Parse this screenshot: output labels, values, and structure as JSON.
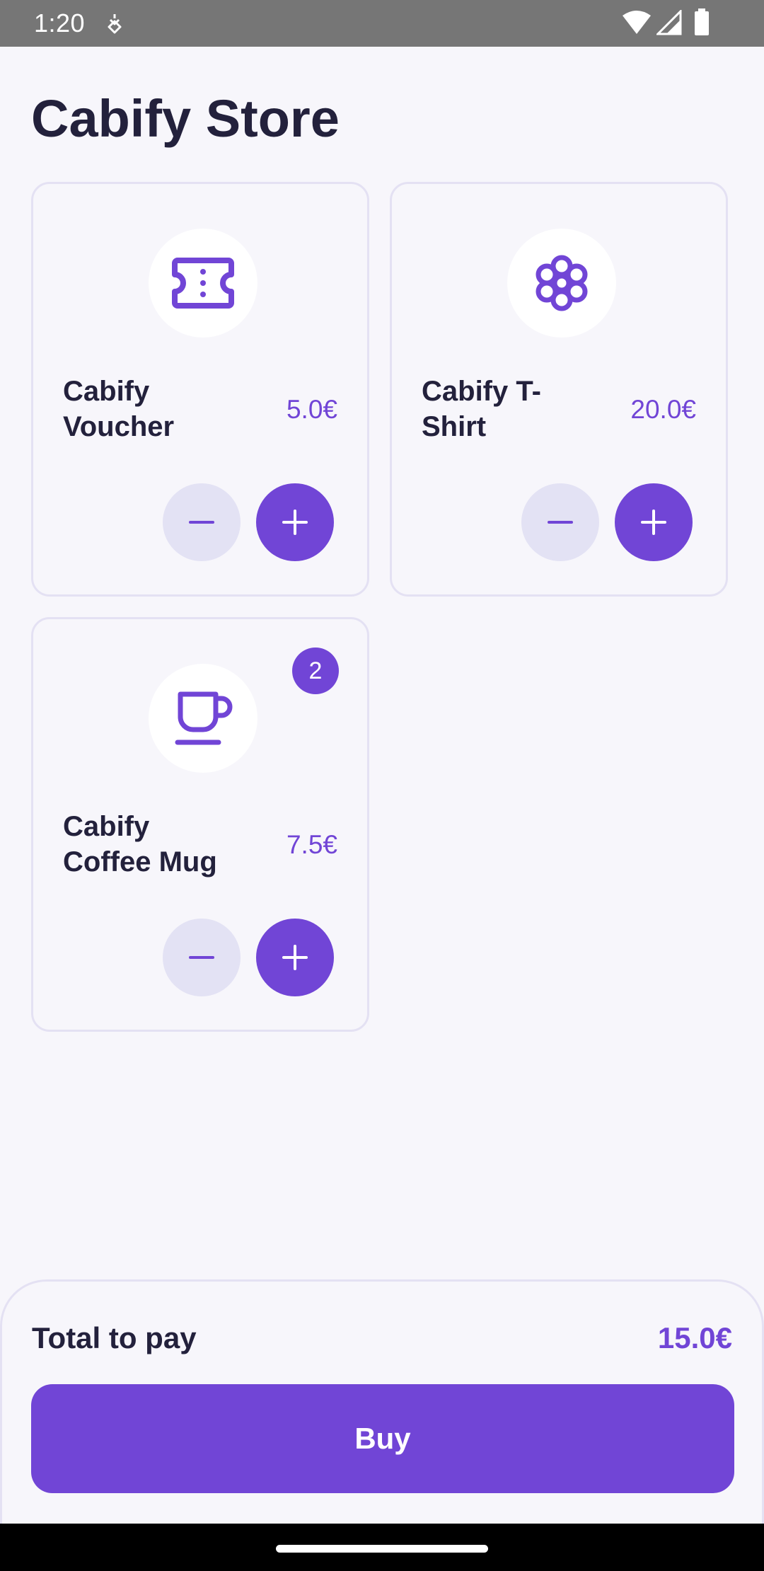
{
  "status_bar": {
    "time": "1:20",
    "icons": [
      "notification-icon",
      "wifi-icon",
      "signal-icon",
      "battery-icon"
    ]
  },
  "header": {
    "title": "Cabify Store"
  },
  "products": [
    {
      "name": "Cabify Voucher",
      "price": "5.0€",
      "icon": "voucher-ticket-icon",
      "quantity": null
    },
    {
      "name": "Cabify T-Shirt",
      "price": "20.0€",
      "icon": "flower-icon",
      "quantity": null
    },
    {
      "name": "Cabify Coffee Mug",
      "price": "7.5€",
      "icon": "coffee-mug-icon",
      "quantity": "2"
    }
  ],
  "cart": {
    "total_label": "Total to pay",
    "total_value": "15.0€",
    "buy_label": "Buy"
  },
  "colors": {
    "accent": "#7145d6",
    "accent_light": "#e3e2f4",
    "text_primary": "#23213c",
    "background": "#f7f6fb",
    "border": "#e4e1f3"
  }
}
